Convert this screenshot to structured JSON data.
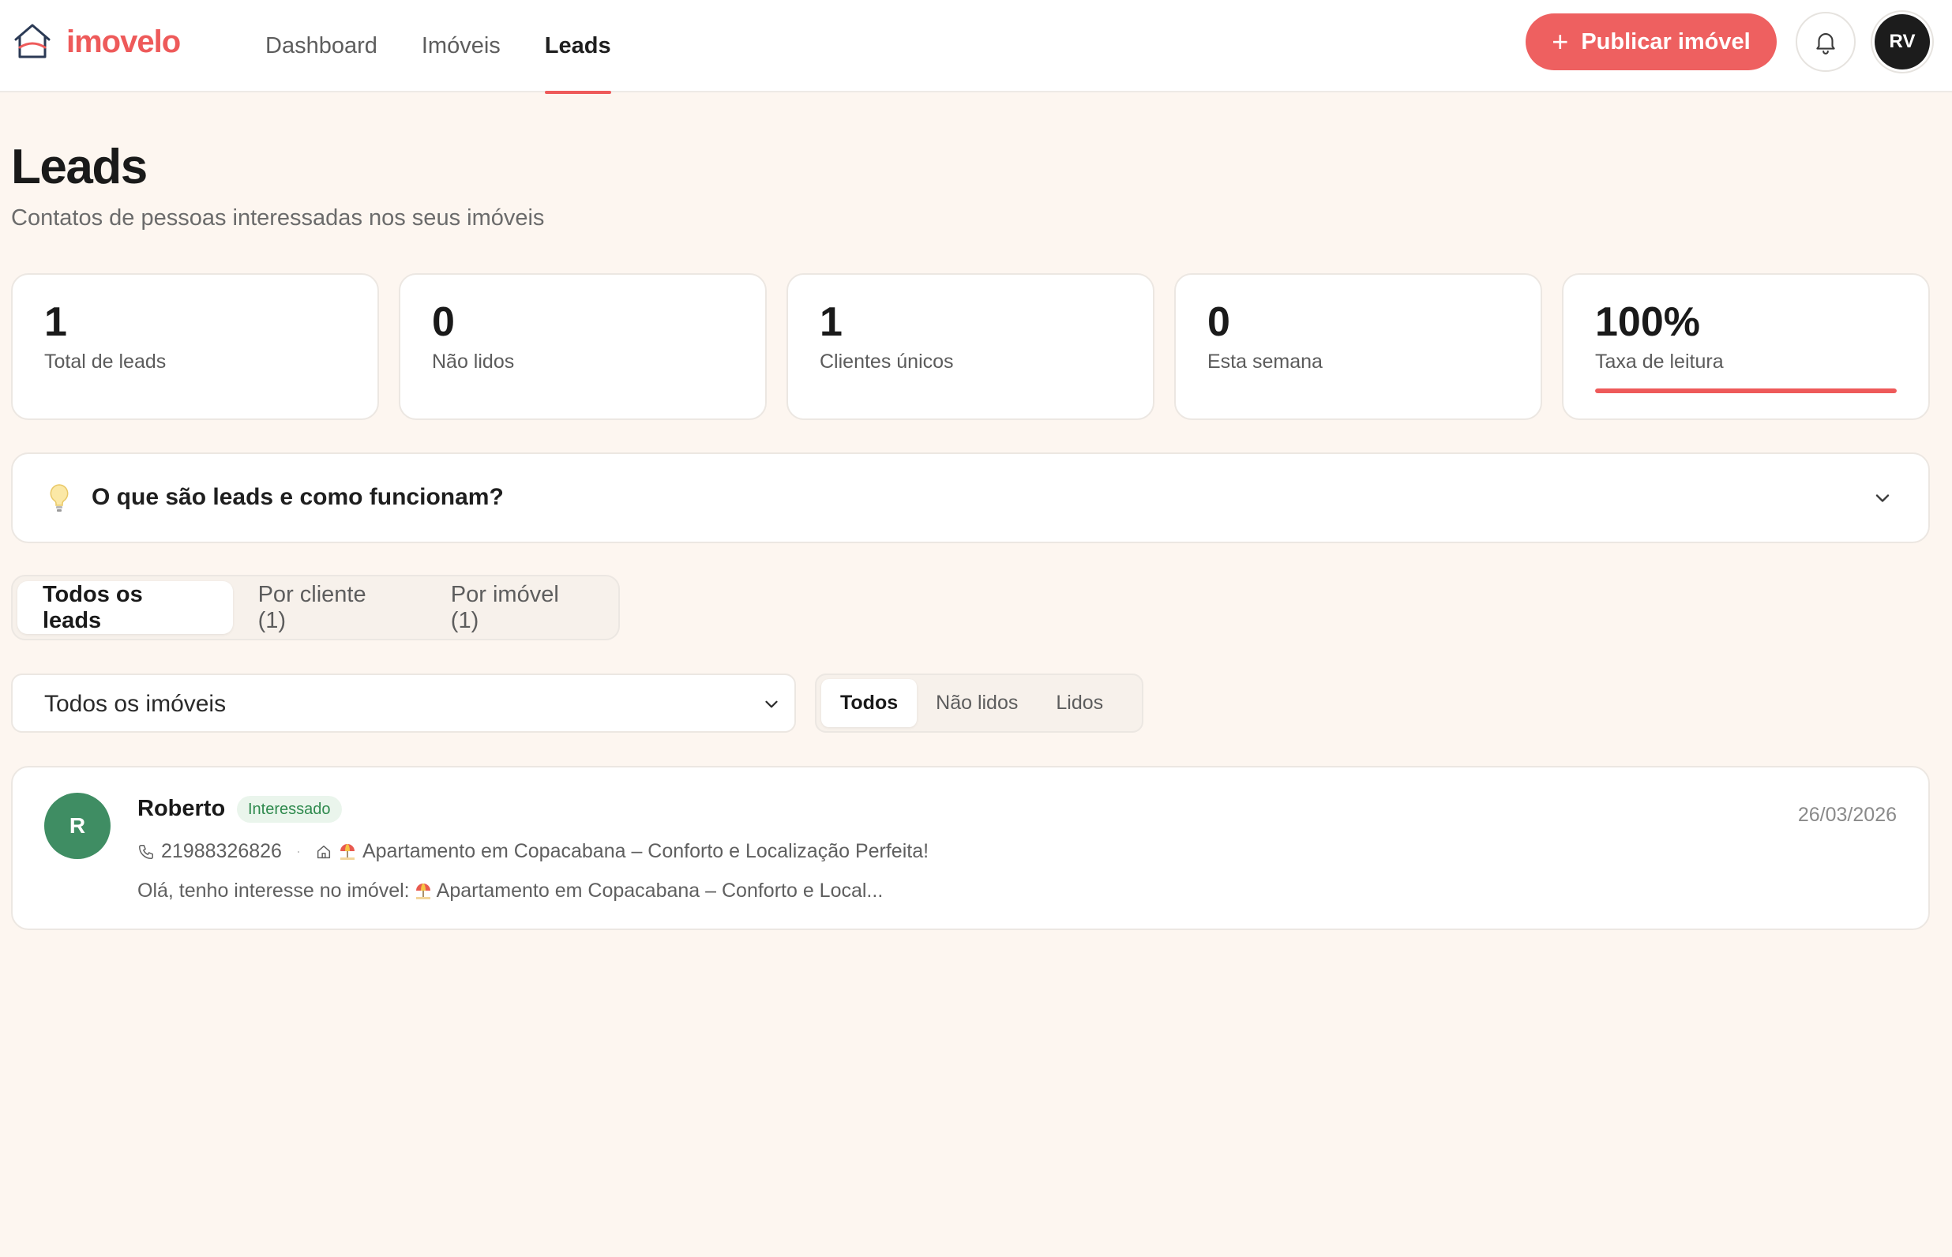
{
  "brand": {
    "name": "imovelo",
    "accent": "#ee5a5a"
  },
  "nav": {
    "items": [
      {
        "label": "Dashboard",
        "active": false
      },
      {
        "label": "Imóveis",
        "active": false
      },
      {
        "label": "Leads",
        "active": true
      }
    ]
  },
  "header_actions": {
    "publish_label": "Publicar imóvel",
    "bell_icon": "bell-icon",
    "avatar_initials": "RV"
  },
  "page": {
    "title": "Leads",
    "subtitle": "Contatos de pessoas interessadas nos seus imóveis"
  },
  "stats": [
    {
      "value": "1",
      "label": "Total de leads"
    },
    {
      "value": "0",
      "label": "Não lidos"
    },
    {
      "value": "1",
      "label": "Clientes únicos"
    },
    {
      "value": "0",
      "label": "Esta semana"
    },
    {
      "value": "100%",
      "label": "Taxa de leitura",
      "progress": 1.0
    }
  ],
  "faq": {
    "icon": "lightbulb-icon",
    "question": "O que são leads e como funcionam?"
  },
  "tabs": [
    {
      "label": "Todos os leads",
      "active": true
    },
    {
      "label": "Por cliente (1)",
      "active": false
    },
    {
      "label": "Por imóvel (1)",
      "active": false
    }
  ],
  "filters": {
    "property_select": {
      "selected": "Todos os imóveis"
    },
    "read_status": [
      {
        "label": "Todos",
        "active": true
      },
      {
        "label": "Não lidos",
        "active": false
      },
      {
        "label": "Lidos",
        "active": false
      }
    ]
  },
  "leads": [
    {
      "initial": "R",
      "name": "Roberto",
      "status": "Interessado",
      "date": "26/03/2026",
      "phone": "21988326826",
      "property": "Apartamento em Copacabana – Conforto e Localização Perfeita!",
      "message_prefix": "Olá, tenho interesse no imóvel:",
      "message_rest": "Apartamento em Copacabana – Conforto e Local..."
    }
  ]
}
